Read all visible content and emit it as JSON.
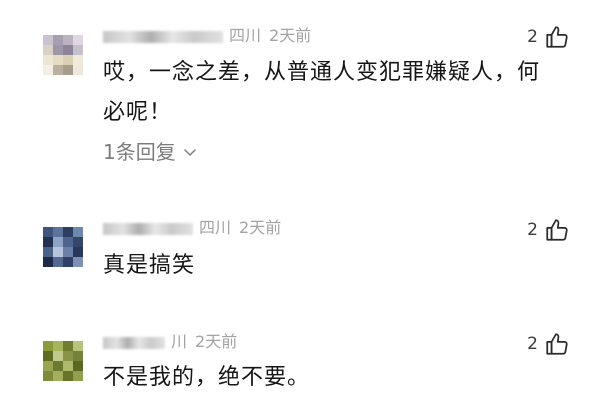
{
  "comments": [
    {
      "location": "四川",
      "time": "2天前",
      "likes": "2",
      "text_lines": [
        "哎，一念之差，从普通人变犯罪嫌疑人，何",
        "必呢！"
      ],
      "replies_label": "1条回复"
    },
    {
      "location": "四川",
      "time": "2天前",
      "likes": "2",
      "text_lines": [
        "真是搞笑"
      ]
    },
    {
      "location": "川",
      "time": "2天前",
      "likes": "2",
      "text_lines": [
        "不是我的，绝不要。"
      ]
    }
  ],
  "icons": {
    "like": "thumbs-up-icon",
    "expand": "chevron-down-icon"
  },
  "colors": {
    "meta_text": "#a3a3a3",
    "reply_link": "#7c7c7c",
    "body_text": "#161616"
  }
}
